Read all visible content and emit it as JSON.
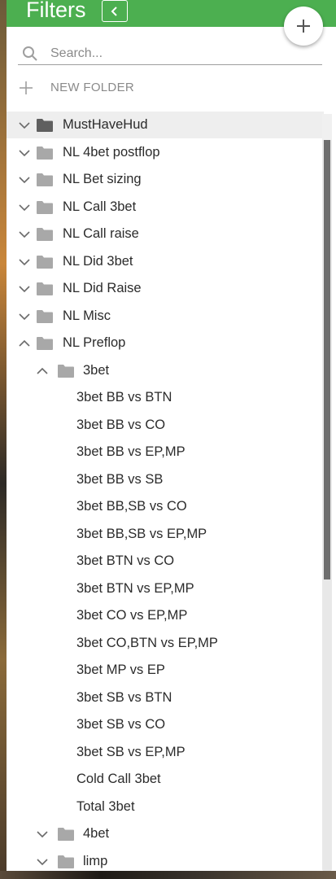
{
  "header": {
    "title": "Filters",
    "collapse_icon": "chevron-left-icon",
    "add_icon": "plus-icon",
    "color": "#4caf50"
  },
  "search": {
    "placeholder": "Search...",
    "value": ""
  },
  "new_folder": {
    "label": "NEW FOLDER",
    "icon": "plus-icon"
  },
  "tree": [
    {
      "label": "MustHaveHud",
      "kind": "folder",
      "level": 0,
      "expanded": false,
      "selected": true
    },
    {
      "label": "NL 4bet postflop",
      "kind": "folder",
      "level": 0,
      "expanded": false
    },
    {
      "label": "NL Bet sizing",
      "kind": "folder",
      "level": 0,
      "expanded": false
    },
    {
      "label": "NL Call 3bet",
      "kind": "folder",
      "level": 0,
      "expanded": false
    },
    {
      "label": "NL Call raise",
      "kind": "folder",
      "level": 0,
      "expanded": false
    },
    {
      "label": "NL Did 3bet",
      "kind": "folder",
      "level": 0,
      "expanded": false
    },
    {
      "label": "NL Did Raise",
      "kind": "folder",
      "level": 0,
      "expanded": false
    },
    {
      "label": "NL Misc",
      "kind": "folder",
      "level": 0,
      "expanded": false
    },
    {
      "label": "NL Preflop",
      "kind": "folder",
      "level": 0,
      "expanded": true
    },
    {
      "label": "3bet",
      "kind": "folder",
      "level": 1,
      "expanded": true
    },
    {
      "label": "3bet BB vs BTN",
      "kind": "item",
      "level": 2
    },
    {
      "label": "3bet BB vs CO",
      "kind": "item",
      "level": 2
    },
    {
      "label": "3bet BB vs EP,MP",
      "kind": "item",
      "level": 2
    },
    {
      "label": "3bet BB vs SB",
      "kind": "item",
      "level": 2
    },
    {
      "label": "3bet BB,SB vs CO",
      "kind": "item",
      "level": 2
    },
    {
      "label": "3bet BB,SB vs EP,MP",
      "kind": "item",
      "level": 2
    },
    {
      "label": "3bet BTN vs CO",
      "kind": "item",
      "level": 2
    },
    {
      "label": "3bet BTN vs EP,MP",
      "kind": "item",
      "level": 2
    },
    {
      "label": "3bet CO vs EP,MP",
      "kind": "item",
      "level": 2
    },
    {
      "label": "3bet CO,BTN vs EP,MP",
      "kind": "item",
      "level": 2
    },
    {
      "label": "3bet MP vs EP",
      "kind": "item",
      "level": 2
    },
    {
      "label": "3bet SB vs BTN",
      "kind": "item",
      "level": 2
    },
    {
      "label": "3bet SB vs CO",
      "kind": "item",
      "level": 2
    },
    {
      "label": "3bet SB vs EP,MP",
      "kind": "item",
      "level": 2
    },
    {
      "label": "Cold Call 3bet",
      "kind": "item",
      "level": 2
    },
    {
      "label": "Total 3bet",
      "kind": "item",
      "level": 2
    },
    {
      "label": "4bet",
      "kind": "folder",
      "level": 1,
      "expanded": false
    },
    {
      "label": "limp",
      "kind": "folder",
      "level": 1,
      "expanded": false
    }
  ]
}
